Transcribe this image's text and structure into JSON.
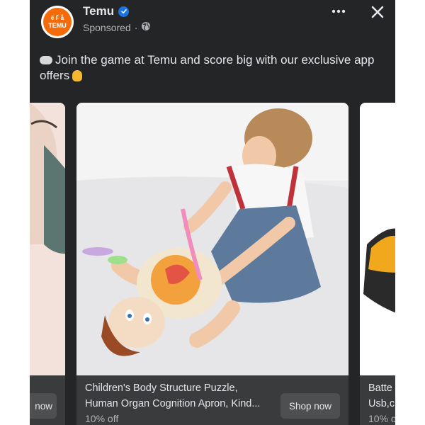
{
  "header": {
    "page_name": "Temu",
    "sponsored": "Sponsored",
    "avatar_line1": "ẽ Ḟ ẫ",
    "avatar_line2": "TEMU"
  },
  "post": {
    "caption": "Join the game at Temu and score big with our exclusive app offers"
  },
  "carousel": {
    "left_card": {
      "shop_label": "now"
    },
    "main_card": {
      "title_line1": "Children's Body Structure Puzzle,",
      "title_line2": "Human Organ Cognition Apron, Kind...",
      "discount": "10% off",
      "shop_label": "Shop now"
    },
    "right_card": {
      "title_line1": "Batte",
      "title_line2": "Usb,c",
      "discount": "10% o"
    }
  },
  "icons": {
    "more": "more-options-icon",
    "close": "close-icon",
    "globe": "globe-icon",
    "verified": "verified-badge-icon"
  },
  "colors": {
    "background": "#242526",
    "card": "#3a3b3c",
    "button": "#4e4f50",
    "text": "#e4e6eb",
    "muted": "#b0b3b8",
    "verified": "#1b74e4",
    "brand": "#f56b0a"
  }
}
